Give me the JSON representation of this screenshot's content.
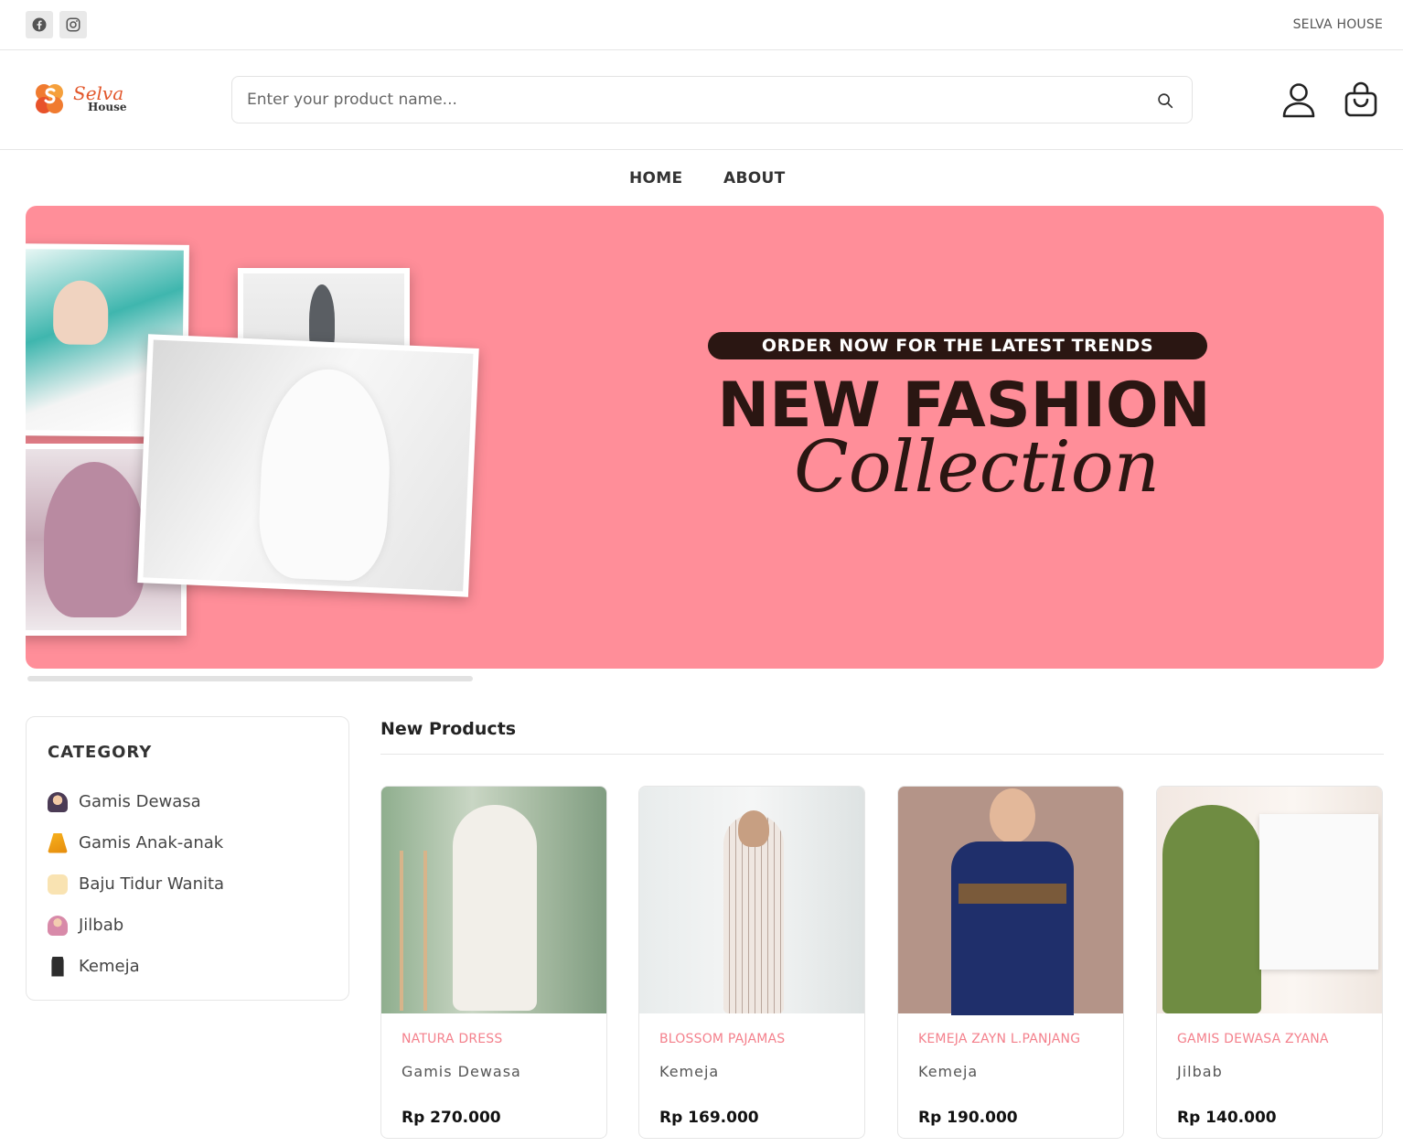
{
  "topbar": {
    "brand": "SELVA HOUSE",
    "social": [
      {
        "icon": "facebook-icon"
      },
      {
        "icon": "instagram-icon"
      }
    ]
  },
  "header": {
    "logo_script": "Selva",
    "logo_sub": "House",
    "search_placeholder": "Enter your product name...",
    "icons": [
      "search-icon",
      "user-icon",
      "shopping-bag-icon"
    ]
  },
  "nav": {
    "home": "HOME",
    "about": "ABOUT"
  },
  "banner": {
    "pill": "ORDER NOW FOR THE LATEST TRENDS",
    "headline": "NEW FASHION",
    "script": "Collection",
    "bg_color": "#ff8e99"
  },
  "sidebar": {
    "title": "CATEGORY",
    "items": [
      {
        "label": "Gamis Dewasa",
        "icon": "woman-hijab-icon"
      },
      {
        "label": "Gamis Anak-anak",
        "icon": "child-dress-icon"
      },
      {
        "label": "Baju Tidur Wanita",
        "icon": "pajamas-icon"
      },
      {
        "label": "Jilbab",
        "icon": "hijab-icon"
      },
      {
        "label": "Kemeja",
        "icon": "shirt-icon"
      }
    ]
  },
  "products": {
    "title": "New Products",
    "items": [
      {
        "name": "NATURA DRESS",
        "category": "Gamis Dewasa",
        "price": "Rp 270.000"
      },
      {
        "name": "BLOSSOM PAJAMAS",
        "category": "Kemeja",
        "price": "Rp 169.000"
      },
      {
        "name": "KEMEJA ZAYN L.PANJANG",
        "category": "Kemeja",
        "price": "Rp 190.000"
      },
      {
        "name": "GAMIS DEWASA ZYANA",
        "category": "Jilbab",
        "price": "Rp 140.000"
      }
    ]
  },
  "colors": {
    "accent": "#f4808c",
    "banner_text": "#2a1612"
  }
}
